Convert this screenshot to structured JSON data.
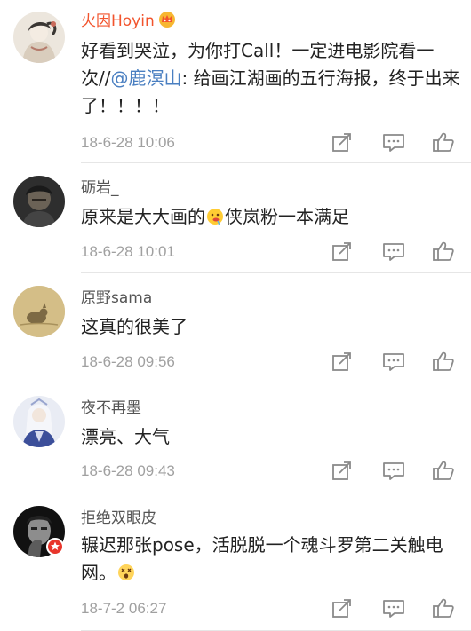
{
  "colors": {
    "highlight_username": "#f2542d",
    "mention": "#4a7fc1",
    "timestamp": "#a0a0a0",
    "divider": "#e6e6e6"
  },
  "comments": [
    {
      "username": "火因Hoyin",
      "badge_icon": "vip-crown-icon",
      "text_before": "好看到哭泣，为你打Call！一定进电影院看一次//",
      "mention": "@鹿溟山",
      "text_after": ": 给画江湖画的五行海报，终于出来了！！！！",
      "timestamp": "18-6-28 10:06"
    },
    {
      "username": "砺岩_",
      "text_before": "原来是大大画的",
      "emoji": "drooling-face-emoji",
      "text_after": "侠岚粉一本满足",
      "timestamp": "18-6-28 10:01"
    },
    {
      "username": "原野sama",
      "text": "这真的很美了",
      "timestamp": "18-6-28 09:56"
    },
    {
      "username": "夜不再墨",
      "text": "漂亮、大气",
      "timestamp": "18-6-28 09:43"
    },
    {
      "username": "拒绝双眼皮",
      "badge_icon": "verified-star-icon",
      "text_before": "辗迟那张pose，活脱脱一个魂斗罗第二关触电网。",
      "emoji": "dizzy-face-emoji",
      "timestamp": "18-7-2 06:27"
    }
  ],
  "actions": [
    "repost-icon",
    "comment-icon",
    "like-icon"
  ]
}
